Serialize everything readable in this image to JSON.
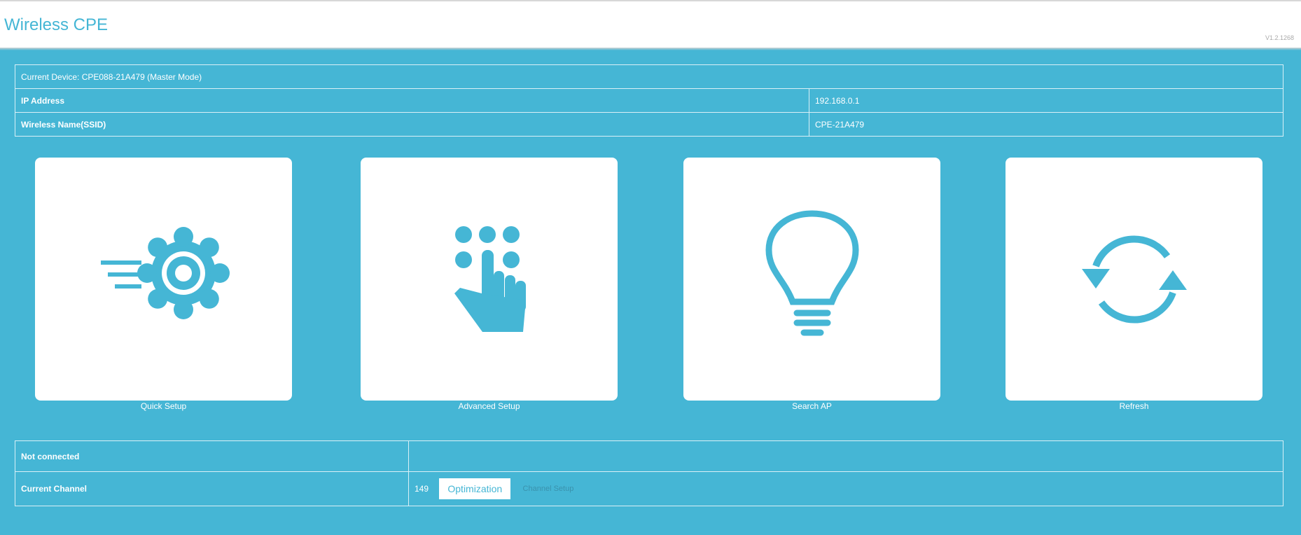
{
  "header": {
    "title": "Wireless CPE",
    "version": "V1.2.1268"
  },
  "device": {
    "current_device": "Current Device: CPE088-21A479 (Master Mode)",
    "rows": [
      {
        "label": "IP Address",
        "value": "192.168.0.1"
      },
      {
        "label": "Wireless Name(SSID)",
        "value": "CPE-21A479"
      }
    ]
  },
  "tiles": [
    {
      "label": "Quick Setup",
      "icon": "gear-speed-icon"
    },
    {
      "label": "Advanced Setup",
      "icon": "touch-keypad-icon"
    },
    {
      "label": "Search AP",
      "icon": "lightbulb-icon"
    },
    {
      "label": "Refresh",
      "icon": "refresh-icon"
    }
  ],
  "status": {
    "connection": "Not connected",
    "channel_label": "Current Channel",
    "channel_value": "149",
    "optimization_label": "Optimization",
    "channel_setup_label": "Channel Setup"
  },
  "colors": {
    "accent": "#45b6d5",
    "background": "#45b6d5",
    "tile": "#ffffff"
  }
}
